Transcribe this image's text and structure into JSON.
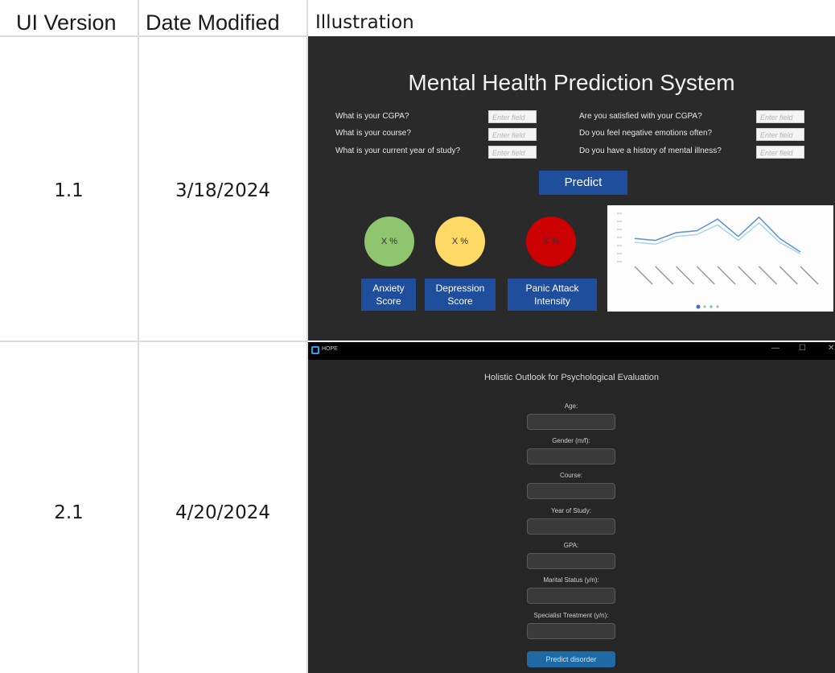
{
  "headers": {
    "ui_version": "UI Version",
    "date_modified": "Date Modified",
    "illustration": "Illustration"
  },
  "rows": [
    {
      "version": "1.1",
      "date": "3/18/2024"
    },
    {
      "version": "2.1",
      "date": "4/20/2024"
    }
  ],
  "v1": {
    "title": "Mental Health Prediction System",
    "questions_left": [
      "What is your CGPA?",
      "What is your course?",
      "What is your current year of study?"
    ],
    "questions_right": [
      "Are you satisfied with your CGPA?",
      "Do you feel negative emotions often?",
      "Do you have a history of mental illness?"
    ],
    "field_placeholder": "Enter field",
    "predict_label": "Predict",
    "circles": [
      {
        "text": "X %",
        "color": "#8fc56e"
      },
      {
        "text": "X %",
        "color": "#ffd966"
      },
      {
        "text": "X %",
        "color": "#cc0000"
      }
    ],
    "score_buttons": [
      {
        "line1": "Anxiety",
        "line2": "Score"
      },
      {
        "line1": "Depression",
        "line2": "Score"
      },
      {
        "line1": "Panic Attack",
        "line2": "Intensity"
      }
    ],
    "chart_data": {
      "type": "line",
      "x": [
        1,
        2,
        3,
        4,
        5,
        6,
        7,
        8,
        9
      ],
      "series": [
        {
          "values": [
            0.12,
            0.11,
            0.15,
            0.16,
            0.22,
            0.13,
            0.23,
            0.12,
            0.05
          ],
          "color": "#5b8fd6"
        },
        {
          "values": [
            0.1,
            0.09,
            0.13,
            0.14,
            0.19,
            0.11,
            0.2,
            0.1,
            0.04
          ],
          "color": "#a8d4f0"
        }
      ],
      "ylim": [
        0,
        0.25
      ],
      "pager_dots": 4
    }
  },
  "v2": {
    "window_title": "HOPE",
    "window_controls": [
      "—",
      "☐",
      "✕"
    ],
    "app_title": "Holistic Outlook for Psychological Evaluation",
    "fields": [
      "Age:",
      "Gender (m/f):",
      "Course:",
      "Year of Study:",
      "GPA:",
      "Marital Status (y/n):",
      "Specialist Treatment (y/n):"
    ],
    "button_label": "Predict disorder"
  }
}
